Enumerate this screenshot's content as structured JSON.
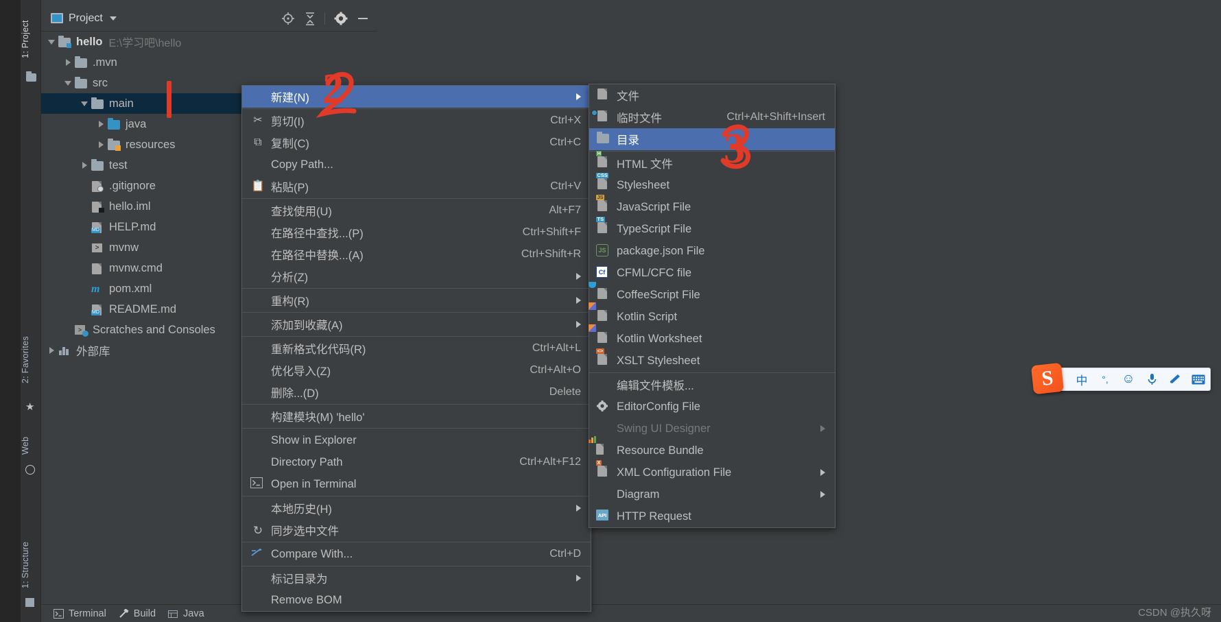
{
  "window": {
    "background_color": "#3c3f41",
    "accent_color": "#4b6eaf",
    "selection_color": "#0d293e"
  },
  "left_rail": {
    "items": [
      {
        "label": "1: Project",
        "name": "rail-project",
        "active": true
      },
      {
        "label": "2: Favorites",
        "name": "rail-favorites",
        "active": false
      },
      {
        "label": "Web",
        "name": "rail-web",
        "active": false
      },
      {
        "label": "1: Structure",
        "name": "rail-structure",
        "active": false
      }
    ]
  },
  "project_panel": {
    "title": "Project",
    "title_icon": "project-window-icon",
    "toolbar": [
      {
        "name": "locate-icon",
        "label": "Select Opened File"
      },
      {
        "name": "collapse-all-icon",
        "label": "Collapse All"
      },
      {
        "name": "gear-icon",
        "label": "Settings"
      },
      {
        "name": "minimize-icon",
        "label": "Hide"
      }
    ],
    "tree": [
      {
        "depth": 0,
        "twisty": "down",
        "icon": "module-folder-icon",
        "label": "hello",
        "bold": true,
        "path": "E:\\学习吧\\hello",
        "selected": false
      },
      {
        "depth": 1,
        "twisty": "right",
        "icon": "folder-icon",
        "label": ".mvn",
        "bold": false,
        "path": "",
        "selected": false
      },
      {
        "depth": 1,
        "twisty": "down",
        "icon": "folder-icon",
        "label": "src",
        "bold": false,
        "path": "",
        "selected": false
      },
      {
        "depth": 2,
        "twisty": "down",
        "icon": "folder-icon",
        "label": "main",
        "bold": false,
        "path": "",
        "selected": true
      },
      {
        "depth": 3,
        "twisty": "right",
        "icon": "source-folder-icon",
        "label": "java",
        "bold": false,
        "path": "",
        "selected": false
      },
      {
        "depth": 3,
        "twisty": "right",
        "icon": "resource-folder-icon",
        "label": "resources",
        "bold": false,
        "path": "",
        "selected": false
      },
      {
        "depth": 2,
        "twisty": "right",
        "icon": "folder-icon",
        "label": "test",
        "bold": false,
        "path": "",
        "selected": false
      },
      {
        "depth": 2,
        "twisty": "none",
        "icon": "gitignore-file-icon",
        "label": ".gitignore",
        "bold": false,
        "path": "",
        "selected": false
      },
      {
        "depth": 2,
        "twisty": "none",
        "icon": "iml-file-icon",
        "label": "hello.iml",
        "bold": false,
        "path": "",
        "selected": false
      },
      {
        "depth": 2,
        "twisty": "none",
        "icon": "markdown-file-icon",
        "label": "HELP.md",
        "bold": false,
        "path": "",
        "selected": false
      },
      {
        "depth": 2,
        "twisty": "none",
        "icon": "shell-script-icon",
        "label": "mvnw",
        "bold": false,
        "path": "",
        "selected": false
      },
      {
        "depth": 2,
        "twisty": "none",
        "icon": "cmd-file-icon",
        "label": "mvnw.cmd",
        "bold": false,
        "path": "",
        "selected": false
      },
      {
        "depth": 2,
        "twisty": "none",
        "icon": "maven-file-icon",
        "label": "pom.xml",
        "bold": false,
        "path": "",
        "selected": false
      },
      {
        "depth": 2,
        "twisty": "none",
        "icon": "markdown-file-icon",
        "label": "README.md",
        "bold": false,
        "path": "",
        "selected": false
      },
      {
        "depth": 1,
        "twisty": "none",
        "icon": "scratches-icon",
        "label": "Scratches and Consoles",
        "bold": false,
        "path": "",
        "selected": false
      },
      {
        "depth": 0,
        "twisty": "right",
        "icon": "external-libs-icon",
        "label": "外部库",
        "bold": false,
        "path": "",
        "selected": false
      }
    ]
  },
  "context_menu": {
    "items": [
      {
        "type": "item",
        "icon": "none",
        "label": "新建(N)",
        "mnemonic": "N",
        "shortcut": "",
        "submenu": true,
        "highlighted": true
      },
      {
        "type": "sep"
      },
      {
        "type": "item",
        "icon": "scissors-icon",
        "label": "剪切(I)",
        "mnemonic": "I",
        "shortcut": "Ctrl+X",
        "submenu": false,
        "highlighted": false
      },
      {
        "type": "item",
        "icon": "copy-icon",
        "label": "复制(C)",
        "mnemonic": "C",
        "shortcut": "Ctrl+C",
        "submenu": false,
        "highlighted": false
      },
      {
        "type": "item",
        "icon": "none",
        "label": "Copy Path...",
        "mnemonic": "",
        "shortcut": "",
        "submenu": false,
        "highlighted": false
      },
      {
        "type": "item",
        "icon": "paste-icon",
        "label": "粘贴(P)",
        "mnemonic": "P",
        "shortcut": "Ctrl+V",
        "submenu": false,
        "highlighted": false
      },
      {
        "type": "sep"
      },
      {
        "type": "item",
        "icon": "none",
        "label": "查找使用(U)",
        "mnemonic": "U",
        "shortcut": "Alt+F7",
        "submenu": false,
        "highlighted": false
      },
      {
        "type": "item",
        "icon": "none",
        "label": "在路径中查找...(P)",
        "mnemonic": "P",
        "shortcut": "Ctrl+Shift+F",
        "submenu": false,
        "highlighted": false
      },
      {
        "type": "item",
        "icon": "none",
        "label": "在路径中替换...(A)",
        "mnemonic": "A",
        "shortcut": "Ctrl+Shift+R",
        "submenu": false,
        "highlighted": false
      },
      {
        "type": "item",
        "icon": "none",
        "label": "分析(Z)",
        "mnemonic": "Z",
        "shortcut": "",
        "submenu": true,
        "highlighted": false
      },
      {
        "type": "sep"
      },
      {
        "type": "item",
        "icon": "none",
        "label": "重构(R)",
        "mnemonic": "R",
        "shortcut": "",
        "submenu": true,
        "highlighted": false
      },
      {
        "type": "sep"
      },
      {
        "type": "item",
        "icon": "none",
        "label": "添加到收藏(A)",
        "mnemonic": "A",
        "shortcut": "",
        "submenu": true,
        "highlighted": false
      },
      {
        "type": "sep"
      },
      {
        "type": "item",
        "icon": "none",
        "label": "重新格式化代码(R)",
        "mnemonic": "R",
        "shortcut": "Ctrl+Alt+L",
        "submenu": false,
        "highlighted": false
      },
      {
        "type": "item",
        "icon": "none",
        "label": "优化导入(Z)",
        "mnemonic": "Z",
        "shortcut": "Ctrl+Alt+O",
        "submenu": false,
        "highlighted": false
      },
      {
        "type": "item",
        "icon": "none",
        "label": "删除...(D)",
        "mnemonic": "D",
        "shortcut": "Delete",
        "submenu": false,
        "highlighted": false
      },
      {
        "type": "sep"
      },
      {
        "type": "item",
        "icon": "none",
        "label": "构建模块(M) 'hello'",
        "mnemonic": "M",
        "shortcut": "",
        "submenu": false,
        "highlighted": false
      },
      {
        "type": "sep"
      },
      {
        "type": "item",
        "icon": "none",
        "label": "Show in Explorer",
        "mnemonic": "",
        "shortcut": "",
        "submenu": false,
        "highlighted": false
      },
      {
        "type": "item",
        "icon": "none",
        "label": "Directory Path",
        "mnemonic": "P",
        "shortcut": "Ctrl+Alt+F12",
        "submenu": false,
        "highlighted": false
      },
      {
        "type": "item",
        "icon": "terminal-icon",
        "label": "Open in Terminal",
        "mnemonic": "",
        "shortcut": "",
        "submenu": false,
        "highlighted": false
      },
      {
        "type": "sep"
      },
      {
        "type": "item",
        "icon": "none",
        "label": "本地历史(H)",
        "mnemonic": "H",
        "shortcut": "",
        "submenu": true,
        "highlighted": false
      },
      {
        "type": "item",
        "icon": "sync-icon",
        "label": "同步选中文件",
        "mnemonic": "",
        "shortcut": "",
        "submenu": false,
        "highlighted": false
      },
      {
        "type": "sep"
      },
      {
        "type": "item",
        "icon": "compare-icon",
        "label": "Compare With...",
        "mnemonic": "",
        "shortcut": "Ctrl+D",
        "submenu": false,
        "highlighted": false
      },
      {
        "type": "sep"
      },
      {
        "type": "item",
        "icon": "none",
        "label": "标记目录为",
        "mnemonic": "",
        "shortcut": "",
        "submenu": true,
        "highlighted": false
      },
      {
        "type": "item",
        "icon": "none",
        "label": "Remove BOM",
        "mnemonic": "",
        "shortcut": "",
        "submenu": false,
        "highlighted": false
      }
    ]
  },
  "submenu": {
    "items": [
      {
        "type": "item",
        "icon": "file-icon",
        "label": "文件",
        "shortcut": "",
        "submenu": false,
        "highlighted": false,
        "disabled": false
      },
      {
        "type": "item",
        "icon": "scratch-file-icon",
        "label": "临时文件",
        "shortcut": "Ctrl+Alt+Shift+Insert",
        "submenu": false,
        "highlighted": false,
        "disabled": false
      },
      {
        "type": "item",
        "icon": "directory-icon",
        "label": "目录",
        "shortcut": "",
        "submenu": false,
        "highlighted": true,
        "disabled": false
      },
      {
        "type": "sep"
      },
      {
        "type": "item",
        "icon": "html-file-icon",
        "label": "HTML 文件",
        "shortcut": "",
        "submenu": false,
        "highlighted": false,
        "disabled": false
      },
      {
        "type": "item",
        "icon": "css-file-icon",
        "label": "Stylesheet",
        "shortcut": "",
        "submenu": false,
        "highlighted": false,
        "disabled": false
      },
      {
        "type": "item",
        "icon": "js-file-icon",
        "label": "JavaScript File",
        "shortcut": "",
        "submenu": false,
        "highlighted": false,
        "disabled": false
      },
      {
        "type": "item",
        "icon": "ts-file-icon",
        "label": "TypeScript File",
        "shortcut": "",
        "submenu": false,
        "highlighted": false,
        "disabled": false
      },
      {
        "type": "item",
        "icon": "json-file-icon",
        "label": "package.json File",
        "shortcut": "",
        "submenu": false,
        "highlighted": false,
        "disabled": false
      },
      {
        "type": "item",
        "icon": "cfml-file-icon",
        "label": "CFML/CFC file",
        "shortcut": "",
        "submenu": false,
        "highlighted": false,
        "disabled": false
      },
      {
        "type": "item",
        "icon": "coffee-file-icon",
        "label": "CoffeeScript File",
        "shortcut": "",
        "submenu": false,
        "highlighted": false,
        "disabled": false
      },
      {
        "type": "item",
        "icon": "kotlin-file-icon",
        "label": "Kotlin Script",
        "shortcut": "",
        "submenu": false,
        "highlighted": false,
        "disabled": false
      },
      {
        "type": "item",
        "icon": "kotlin-file-icon",
        "label": "Kotlin Worksheet",
        "shortcut": "",
        "submenu": false,
        "highlighted": false,
        "disabled": false
      },
      {
        "type": "item",
        "icon": "xslt-file-icon",
        "label": "XSLT Stylesheet",
        "shortcut": "",
        "submenu": false,
        "highlighted": false,
        "disabled": false
      },
      {
        "type": "sep"
      },
      {
        "type": "item",
        "icon": "none",
        "label": "编辑文件模板...",
        "shortcut": "",
        "submenu": false,
        "highlighted": false,
        "disabled": false
      },
      {
        "type": "item",
        "icon": "gear-icon",
        "label": "EditorConfig File",
        "shortcut": "",
        "submenu": false,
        "highlighted": false,
        "disabled": false
      },
      {
        "type": "item",
        "icon": "none",
        "label": "Swing UI Designer",
        "shortcut": "",
        "submenu": true,
        "highlighted": false,
        "disabled": true
      },
      {
        "type": "item",
        "icon": "bundle-icon",
        "label": "Resource Bundle",
        "shortcut": "",
        "submenu": false,
        "highlighted": false,
        "disabled": false
      },
      {
        "type": "item",
        "icon": "xml-file-icon",
        "label": "XML Configuration File",
        "shortcut": "",
        "submenu": true,
        "highlighted": false,
        "disabled": false
      },
      {
        "type": "item",
        "icon": "none",
        "label": "Diagram",
        "shortcut": "",
        "submenu": true,
        "highlighted": false,
        "disabled": false
      },
      {
        "type": "item",
        "icon": "http-icon",
        "label": "HTTP Request",
        "shortcut": "",
        "submenu": false,
        "highlighted": false,
        "disabled": false
      }
    ]
  },
  "bottom_bar": {
    "items": [
      {
        "label": "Terminal",
        "icon": "terminal-icon"
      },
      {
        "label": "Build",
        "icon": "build-hammer-icon"
      },
      {
        "label": "Java",
        "icon": "java-enterprise-icon"
      }
    ]
  },
  "annotations": [
    {
      "name": "annotation-bar-1",
      "text": "",
      "color": "#e23a28"
    },
    {
      "name": "annotation-number-2",
      "text": "2",
      "color": "#e23a28"
    },
    {
      "name": "annotation-number-3",
      "text": "3",
      "color": "#e23a28"
    }
  ],
  "ime_bar": {
    "logo": "S",
    "buttons": [
      {
        "name": "language-mode-icon",
        "glyph": "中"
      },
      {
        "name": "punctuation-mode-icon",
        "glyph": "°,"
      },
      {
        "name": "emoji-icon",
        "glyph": "☺"
      },
      {
        "name": "voice-input-icon",
        "glyph": "🎤"
      },
      {
        "name": "handwriting-icon",
        "glyph": "✎"
      },
      {
        "name": "soft-keyboard-icon",
        "glyph": "⌨"
      }
    ]
  },
  "watermark": {
    "text": "CSDN @执久呀"
  }
}
